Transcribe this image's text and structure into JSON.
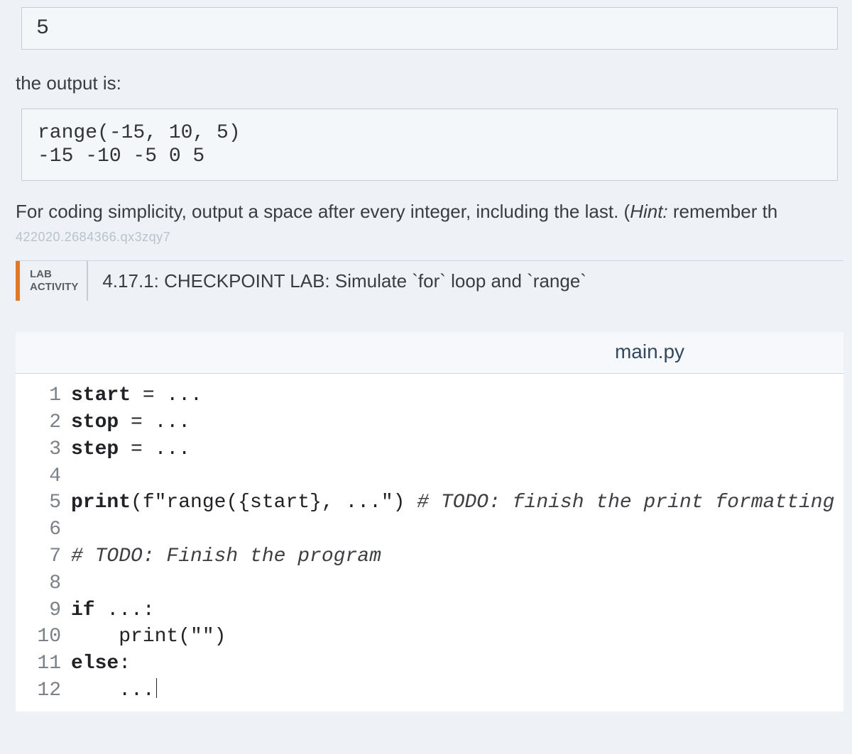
{
  "prompt": {
    "input_value": "5",
    "output_label": "the output is:",
    "example_output": {
      "line1": "range(-15, 10, 5)",
      "line2": "-15 -10 -5 0 5"
    },
    "instruction_prefix": "For coding simplicity, output a space after every integer, including the last. (",
    "instruction_hint_label": "Hint:",
    "instruction_suffix": " remember th",
    "watermark": "422020.2684366.qx3zqy7"
  },
  "lab": {
    "tag_line1": "LAB",
    "tag_line2": "ACTIVITY",
    "title": "4.17.1: CHECKPOINT LAB: Simulate `for` loop and `range`"
  },
  "editor": {
    "filename": "main.py",
    "lines": [
      {
        "n": "1",
        "kw": "start",
        "rest": " = ..."
      },
      {
        "n": "2",
        "kw": "stop",
        "rest": " = ..."
      },
      {
        "n": "3",
        "kw": "step",
        "rest": " = ..."
      },
      {
        "n": "4",
        "kw": "",
        "rest": ""
      },
      {
        "n": "5",
        "kw": "print",
        "rest": "(f\"range({start}, ...\")",
        "cm": " # TODO: finish the print formatting"
      },
      {
        "n": "6",
        "kw": "",
        "rest": ""
      },
      {
        "n": "7",
        "kw": "",
        "rest": "",
        "cm": "# TODO: Finish the program"
      },
      {
        "n": "8",
        "kw": "",
        "rest": ""
      },
      {
        "n": "9",
        "kw": "if",
        "rest": " ...:"
      },
      {
        "n": "10",
        "kw": "",
        "rest": "    print(\"\")"
      },
      {
        "n": "11",
        "kw": "else",
        "rest": ":"
      },
      {
        "n": "12",
        "kw": "",
        "rest": "    ...",
        "cursor": true
      }
    ]
  }
}
